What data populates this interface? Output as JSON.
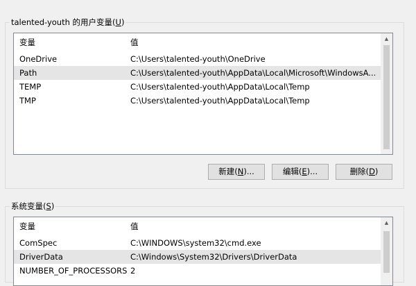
{
  "user_vars": {
    "label_prefix": "talented-youth 的用户变量(",
    "label_key": "U",
    "label_suffix": ")",
    "columns": [
      "变量",
      "值"
    ],
    "rows": [
      {
        "name": "OneDrive",
        "value": "C:\\Users\\talented-youth\\OneDrive"
      },
      {
        "name": "Path",
        "value": "C:\\Users\\talented-youth\\AppData\\Local\\Microsoft\\WindowsA..."
      },
      {
        "name": "TEMP",
        "value": "C:\\Users\\talented-youth\\AppData\\Local\\Temp"
      },
      {
        "name": "TMP",
        "value": "C:\\Users\\talented-youth\\AppData\\Local\\Temp"
      }
    ],
    "selected_row": "Path",
    "buttons": {
      "new": {
        "prefix": "新建(",
        "key": "N",
        "suffix": ")..."
      },
      "edit": {
        "prefix": "编辑(",
        "key": "E",
        "suffix": ")..."
      },
      "delete": {
        "prefix": "删除(",
        "key": "D",
        "suffix": ")"
      }
    }
  },
  "system_vars": {
    "label_prefix": "系统变量(",
    "label_key": "S",
    "label_suffix": ")",
    "columns": [
      "变量",
      "值"
    ],
    "rows": [
      {
        "name": "ComSpec",
        "value": "C:\\WINDOWS\\system32\\cmd.exe"
      },
      {
        "name": "DriverData",
        "value": "C:\\Windows\\System32\\Drivers\\DriverData"
      },
      {
        "name": "NUMBER_OF_PROCESSORS",
        "value": "2"
      }
    ],
    "selected_row": "DriverData"
  }
}
